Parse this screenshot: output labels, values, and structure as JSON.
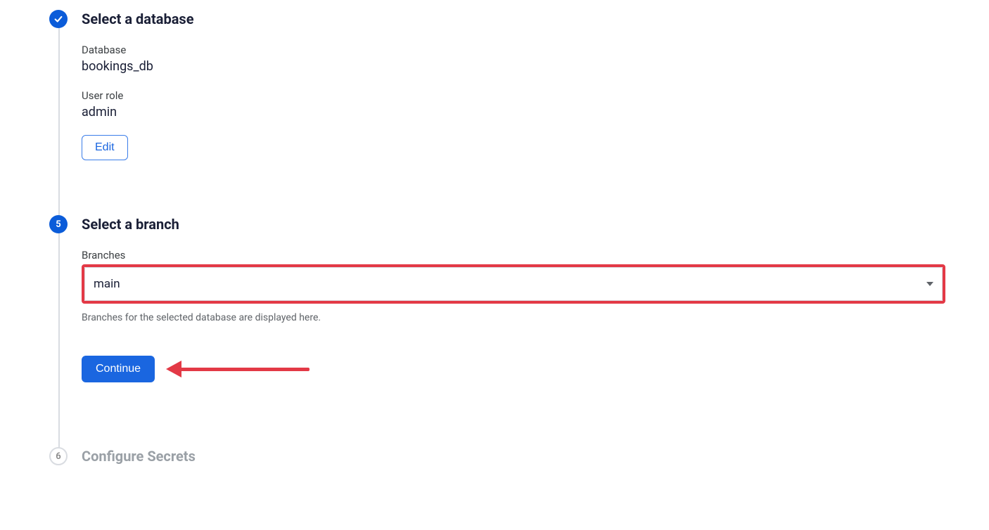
{
  "colors": {
    "accent": "#1a66e0",
    "highlight": "#e33946"
  },
  "steps": {
    "database": {
      "title": "Select a database",
      "fields": {
        "dbLabel": "Database",
        "dbValue": "bookings_db",
        "roleLabel": "User role",
        "roleValue": "admin"
      },
      "editLabel": "Edit"
    },
    "branch": {
      "number": "5",
      "title": "Select a branch",
      "fieldLabel": "Branches",
      "selectedValue": "main",
      "helper": "Branches for the selected database are displayed here.",
      "continueLabel": "Continue"
    },
    "secrets": {
      "number": "6",
      "title": "Configure Secrets"
    }
  }
}
